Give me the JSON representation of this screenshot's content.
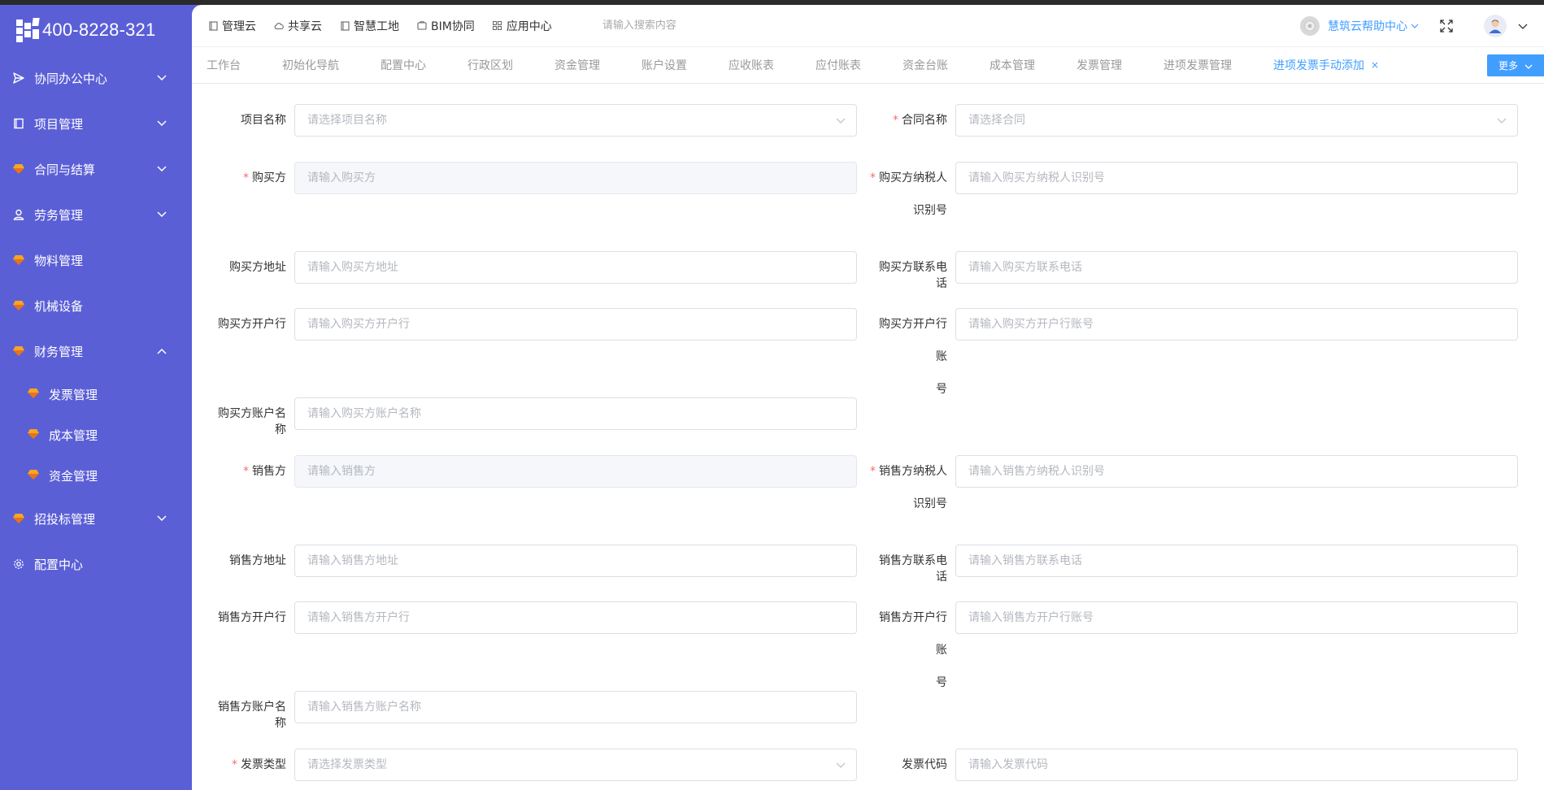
{
  "brand": {
    "phone": "400-8228-321"
  },
  "sidebar": {
    "items": [
      {
        "label": "协同办公中心",
        "icon": "send-icon",
        "expanded": false
      },
      {
        "label": "项目管理",
        "icon": "book-icon",
        "expanded": false
      },
      {
        "label": "合同与结算",
        "icon": "gem-icon",
        "expanded": false
      },
      {
        "label": "劳务管理",
        "icon": "worker-icon",
        "expanded": false
      },
      {
        "label": "物料管理",
        "icon": "gem-icon"
      },
      {
        "label": "机械设备",
        "icon": "gem-icon"
      },
      {
        "label": "财务管理",
        "icon": "gem-icon",
        "expanded": true
      },
      {
        "label": "招投标管理",
        "icon": "gem-icon",
        "expanded": false
      },
      {
        "label": "配置中心",
        "icon": "gear-icon"
      }
    ],
    "finance_children": [
      {
        "label": "发票管理"
      },
      {
        "label": "成本管理"
      },
      {
        "label": "资金管理"
      }
    ]
  },
  "topbar": {
    "nav": [
      {
        "label": "管理云",
        "icon": "doc-icon"
      },
      {
        "label": "共享云",
        "icon": "cloud-icon"
      },
      {
        "label": "智慧工地",
        "icon": "doc-icon"
      },
      {
        "label": "BIM协同",
        "icon": "bim-icon"
      },
      {
        "label": "应用中心",
        "icon": "grid-icon"
      }
    ],
    "search_placeholder": "请输入搜索内容",
    "help_label": "慧筑云帮助中心"
  },
  "tabs": {
    "items": [
      "工作台",
      "初始化导航",
      "配置中心",
      "行政区划",
      "资金管理",
      "账户设置",
      "应收账表",
      "应付账表",
      "资金台账",
      "成本管理",
      "发票管理",
      "进项发票管理"
    ],
    "active": "进项发票手动添加",
    "close": "×",
    "more_label": "更多"
  },
  "form": {
    "project_name": {
      "label": "项目名称",
      "required": false,
      "placeholder": "请选择项目名称"
    },
    "contract_name": {
      "label": "合同名称",
      "required": true,
      "placeholder": "请选择合同"
    },
    "buyer": {
      "label": "购买方",
      "required": true,
      "placeholder": "请输入购买方"
    },
    "buyer_tax_id": {
      "label_line1": "购买方纳税人",
      "label_line2": "识别号",
      "required": true,
      "placeholder": "请输入购买方纳税人识别号"
    },
    "buyer_address": {
      "label": "购买方地址",
      "placeholder": "请输入购买方地址"
    },
    "buyer_phone": {
      "label": "购买方联系电话",
      "placeholder": "请输入购买方联系电话"
    },
    "buyer_bank": {
      "label": "购买方开户行",
      "placeholder": "请输入购买方开户行"
    },
    "buyer_bank_account": {
      "label_line1": "购买方开户行账",
      "label_line2": "号",
      "placeholder": "请输入购买方开户行账号"
    },
    "buyer_account_name": {
      "label": "购买方账户名称",
      "placeholder": "请输入购买方账户名称"
    },
    "seller": {
      "label": "销售方",
      "required": true,
      "placeholder": "请输入销售方"
    },
    "seller_tax_id": {
      "label_line1": "销售方纳税人",
      "label_line2": "识别号",
      "required": true,
      "placeholder": "请输入销售方纳税人识别号"
    },
    "seller_address": {
      "label": "销售方地址",
      "placeholder": "请输入销售方地址"
    },
    "seller_phone": {
      "label": "销售方联系电话",
      "placeholder": "请输入销售方联系电话"
    },
    "seller_bank": {
      "label": "销售方开户行",
      "placeholder": "请输入销售方开户行"
    },
    "seller_bank_account": {
      "label_line1": "销售方开户行账",
      "label_line2": "号",
      "placeholder": "请输入销售方开户行账号"
    },
    "seller_account_name": {
      "label": "销售方账户名称",
      "placeholder": "请输入销售方账户名称"
    },
    "invoice_type": {
      "label": "发票类型",
      "required": true,
      "placeholder": "请选择发票类型"
    },
    "invoice_code": {
      "label": "发票代码",
      "placeholder": "请输入发票代码"
    }
  },
  "colors": {
    "sidebar_bg": "#5b5fd6",
    "accent": "#409eff",
    "required": "#f56c6c"
  }
}
